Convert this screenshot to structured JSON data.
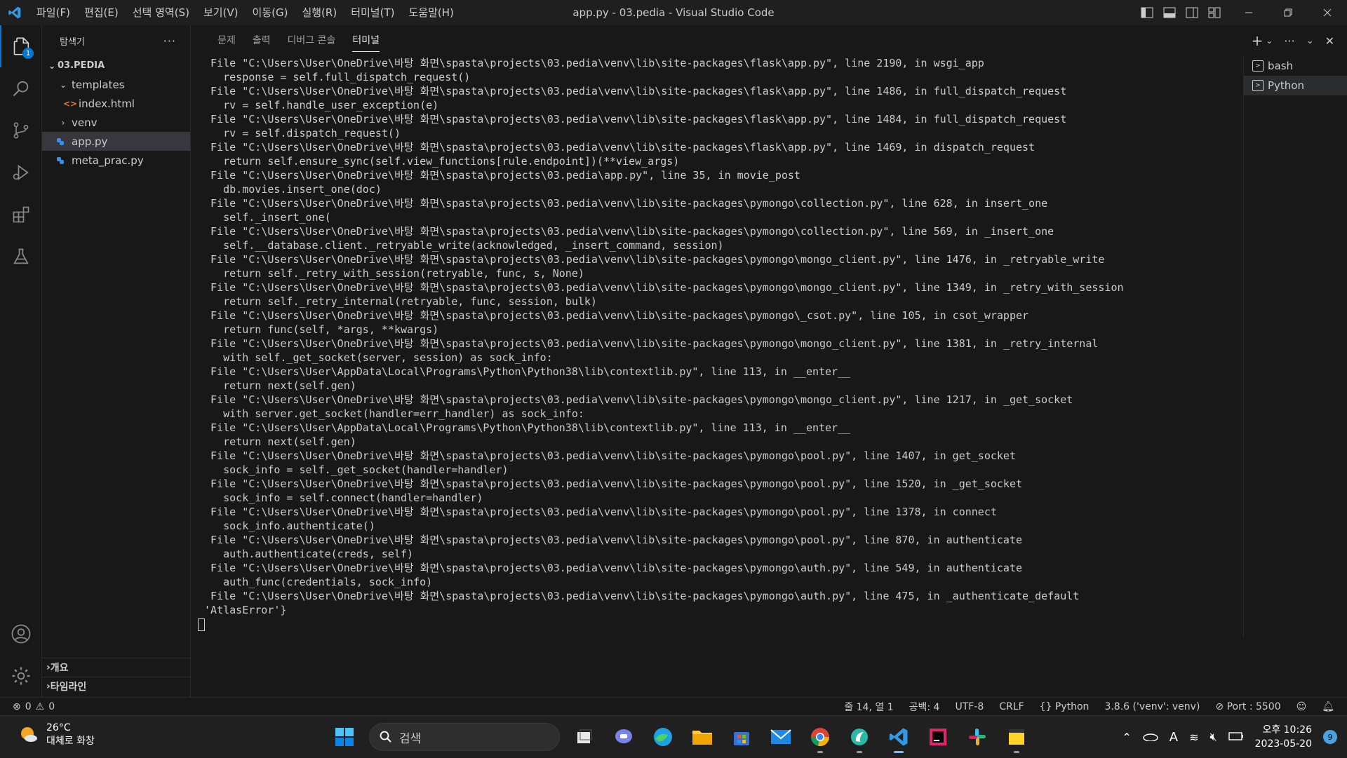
{
  "window": {
    "title": "app.py - 03.pedia - Visual Studio Code",
    "menu": [
      "파일(F)",
      "편집(E)",
      "선택 영역(S)",
      "보기(V)",
      "이동(G)",
      "실행(R)",
      "터미널(T)",
      "도움말(H)"
    ]
  },
  "activity": {
    "explorer_badge": "1"
  },
  "sidebar": {
    "title": "탐색기",
    "more": "···",
    "root": "03.PEDIA",
    "items": [
      {
        "label": "templates",
        "indent": 1,
        "kind": "folder-open"
      },
      {
        "label": "index.html",
        "indent": 2,
        "kind": "html"
      },
      {
        "label": "venv",
        "indent": 1,
        "kind": "folder-closed"
      },
      {
        "label": "app.py",
        "indent": 1,
        "kind": "python",
        "selected": true
      },
      {
        "label": "meta_prac.py",
        "indent": 1,
        "kind": "python"
      }
    ],
    "outline": "개요",
    "timeline": "타임라인"
  },
  "panel": {
    "tabs": [
      "문제",
      "출력",
      "디버그 콘솔",
      "터미널"
    ],
    "active_tab": 3
  },
  "terminal": {
    "lines": [
      "  File \"C:\\Users\\User\\OneDrive\\바탕 화면\\spasta\\projects\\03.pedia\\venv\\lib\\site-packages\\flask\\app.py\", line 2190, in wsgi_app",
      "    response = self.full_dispatch_request()",
      "  File \"C:\\Users\\User\\OneDrive\\바탕 화면\\spasta\\projects\\03.pedia\\venv\\lib\\site-packages\\flask\\app.py\", line 1486, in full_dispatch_request",
      "    rv = self.handle_user_exception(e)",
      "  File \"C:\\Users\\User\\OneDrive\\바탕 화면\\spasta\\projects\\03.pedia\\venv\\lib\\site-packages\\flask\\app.py\", line 1484, in full_dispatch_request",
      "    rv = self.dispatch_request()",
      "  File \"C:\\Users\\User\\OneDrive\\바탕 화면\\spasta\\projects\\03.pedia\\venv\\lib\\site-packages\\flask\\app.py\", line 1469, in dispatch_request",
      "    return self.ensure_sync(self.view_functions[rule.endpoint])(**view_args)",
      "  File \"C:\\Users\\User\\OneDrive\\바탕 화면\\spasta\\projects\\03.pedia\\app.py\", line 35, in movie_post",
      "    db.movies.insert_one(doc)",
      "  File \"C:\\Users\\User\\OneDrive\\바탕 화면\\spasta\\projects\\03.pedia\\venv\\lib\\site-packages\\pymongo\\collection.py\", line 628, in insert_one",
      "    self._insert_one(",
      "  File \"C:\\Users\\User\\OneDrive\\바탕 화면\\spasta\\projects\\03.pedia\\venv\\lib\\site-packages\\pymongo\\collection.py\", line 569, in _insert_one",
      "    self.__database.client._retryable_write(acknowledged, _insert_command, session)",
      "  File \"C:\\Users\\User\\OneDrive\\바탕 화면\\spasta\\projects\\03.pedia\\venv\\lib\\site-packages\\pymongo\\mongo_client.py\", line 1476, in _retryable_write",
      "    return self._retry_with_session(retryable, func, s, None)",
      "  File \"C:\\Users\\User\\OneDrive\\바탕 화면\\spasta\\projects\\03.pedia\\venv\\lib\\site-packages\\pymongo\\mongo_client.py\", line 1349, in _retry_with_session",
      "    return self._retry_internal(retryable, func, session, bulk)",
      "  File \"C:\\Users\\User\\OneDrive\\바탕 화면\\spasta\\projects\\03.pedia\\venv\\lib\\site-packages\\pymongo\\_csot.py\", line 105, in csot_wrapper",
      "    return func(self, *args, **kwargs)",
      "  File \"C:\\Users\\User\\OneDrive\\바탕 화면\\spasta\\projects\\03.pedia\\venv\\lib\\site-packages\\pymongo\\mongo_client.py\", line 1381, in _retry_internal",
      "    with self._get_socket(server, session) as sock_info:",
      "  File \"C:\\Users\\User\\AppData\\Local\\Programs\\Python\\Python38\\lib\\contextlib.py\", line 113, in __enter__",
      "    return next(self.gen)",
      "  File \"C:\\Users\\User\\OneDrive\\바탕 화면\\spasta\\projects\\03.pedia\\venv\\lib\\site-packages\\pymongo\\mongo_client.py\", line 1217, in _get_socket",
      "    with server.get_socket(handler=err_handler) as sock_info:",
      "  File \"C:\\Users\\User\\AppData\\Local\\Programs\\Python\\Python38\\lib\\contextlib.py\", line 113, in __enter__",
      "    return next(self.gen)",
      "  File \"C:\\Users\\User\\OneDrive\\바탕 화면\\spasta\\projects\\03.pedia\\venv\\lib\\site-packages\\pymongo\\pool.py\", line 1407, in get_socket",
      "    sock_info = self._get_socket(handler=handler)",
      "  File \"C:\\Users\\User\\OneDrive\\바탕 화면\\spasta\\projects\\03.pedia\\venv\\lib\\site-packages\\pymongo\\pool.py\", line 1520, in _get_socket",
      "    sock_info = self.connect(handler=handler)",
      "  File \"C:\\Users\\User\\OneDrive\\바탕 화면\\spasta\\projects\\03.pedia\\venv\\lib\\site-packages\\pymongo\\pool.py\", line 1378, in connect",
      "    sock_info.authenticate()",
      "  File \"C:\\Users\\User\\OneDrive\\바탕 화면\\spasta\\projects\\03.pedia\\venv\\lib\\site-packages\\pymongo\\pool.py\", line 870, in authenticate",
      "    auth.authenticate(creds, self)",
      "  File \"C:\\Users\\User\\OneDrive\\바탕 화면\\spasta\\projects\\03.pedia\\venv\\lib\\site-packages\\pymongo\\auth.py\", line 549, in authenticate",
      "    auth_func(credentials, sock_info)",
      "  File \"C:\\Users\\User\\OneDrive\\바탕 화면\\spasta\\projects\\03.pedia\\venv\\lib\\site-packages\\pymongo\\auth.py\", line 475, in _authenticate_default",
      " 'AtlasError'}"
    ]
  },
  "terminal_list": [
    {
      "label": "bash",
      "selected": false
    },
    {
      "label": "Python",
      "selected": true
    }
  ],
  "status": {
    "errors": "0",
    "warnings": "0",
    "position": "줄 14, 열 1",
    "spaces": "공백: 4",
    "encoding": "UTF-8",
    "eol": "CRLF",
    "language": "Python",
    "interpreter": "3.8.6 ('venv': venv)",
    "port": "Port : 5500"
  },
  "taskbar": {
    "temperature": "26°C",
    "weather": "대체로 화창",
    "search_placeholder": "검색",
    "time": "오후 10:26",
    "date": "2023-05-20",
    "notifications": "9"
  },
  "colors": {
    "accent": "#0078d4",
    "python_icon": "#3b8eea",
    "html_icon": "#e37933"
  }
}
